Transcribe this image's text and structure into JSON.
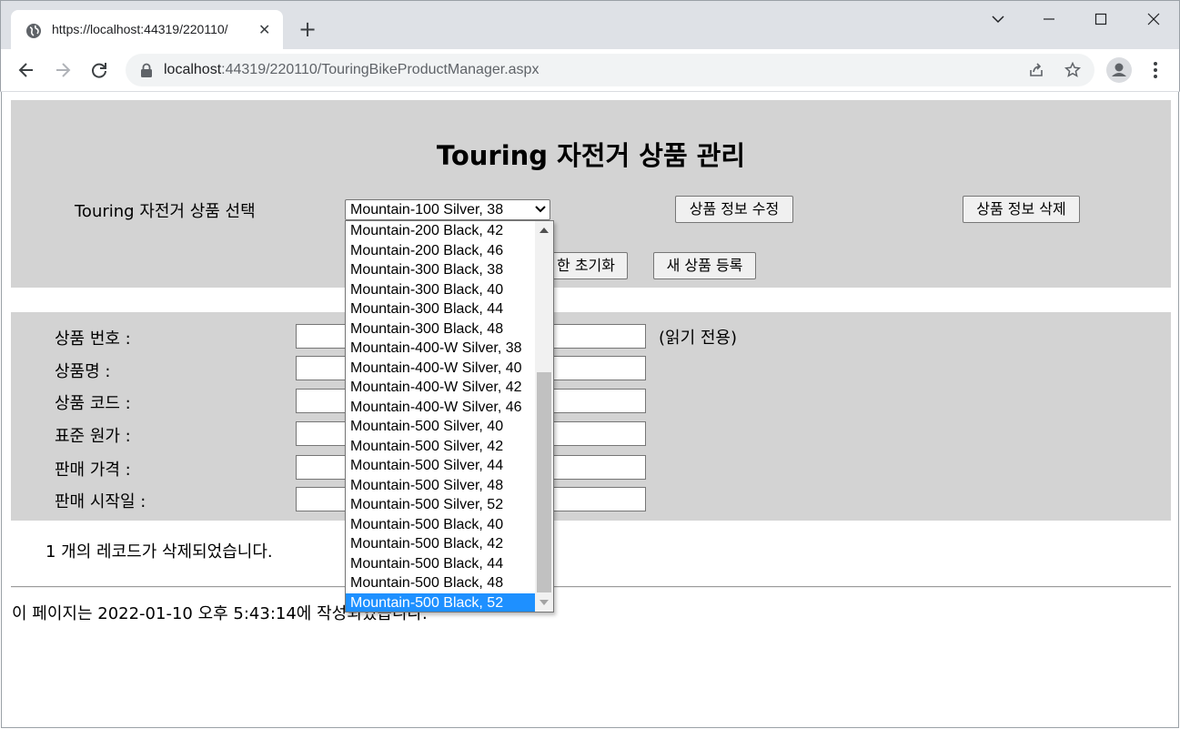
{
  "browser": {
    "tab_title": "https://localhost:44319/220110/",
    "tab_close": "✕",
    "new_tab": "+",
    "url_host": "localhost",
    "url_rest": ":44319/220110/TouringBikeProductManager.aspx",
    "window_controls": {
      "minimize": "—",
      "maximize": "☐",
      "close": "✕",
      "tab_search": "⌄"
    }
  },
  "header": {
    "title": "Touring 자전거 상품 관리",
    "select_label": "Touring 자전거 상품 선택",
    "selected_product": "Mountain-100 Silver, 38",
    "edit_button": "상품 정보 수정",
    "delete_button": "상품 정보 삭제",
    "reset_button": "한 초기화",
    "new_button": "새 상품 등록"
  },
  "form": {
    "fields": [
      {
        "label": "상품 번호 :",
        "value": ""
      },
      {
        "label": "상품명 :",
        "value": ""
      },
      {
        "label": "상품 코드 :",
        "value": ""
      },
      {
        "label": "표준 원가 :",
        "value": ""
      },
      {
        "label": "판매 가격 :",
        "value": ""
      },
      {
        "label": "판매 시작일 :",
        "value": ""
      }
    ],
    "readonly_note": "(읽기 전용)"
  },
  "status_message": "1 개의 레코드가 삭제되었습니다.",
  "footer": "이 페이지는 2022-01-10 오후 5:43:14에 작성되었습니다.",
  "dropdown": {
    "options": [
      "Mountain-200 Black, 42",
      "Mountain-200 Black, 46",
      "Mountain-300 Black, 38",
      "Mountain-300 Black, 40",
      "Mountain-300 Black, 44",
      "Mountain-300 Black, 48",
      "Mountain-400-W Silver, 38",
      "Mountain-400-W Silver, 40",
      "Mountain-400-W Silver, 42",
      "Mountain-400-W Silver, 46",
      "Mountain-500 Silver, 40",
      "Mountain-500 Silver, 42",
      "Mountain-500 Silver, 44",
      "Mountain-500 Silver, 48",
      "Mountain-500 Silver, 52",
      "Mountain-500 Black, 40",
      "Mountain-500 Black, 42",
      "Mountain-500 Black, 44",
      "Mountain-500 Black, 48",
      "Mountain-500 Black, 52"
    ],
    "highlighted": "Mountain-500 Black, 52"
  },
  "colors": {
    "panel": "#d3d3d3",
    "highlight": "#1e90ff",
    "chrome": "#dee1e6"
  }
}
